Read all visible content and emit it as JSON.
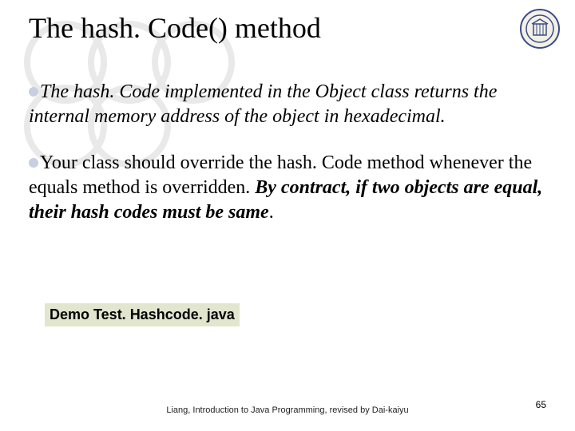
{
  "title": "The hash. Code() method",
  "bullets": {
    "b1": {
      "run1": "The hash. Code implemented in the Object class returns the internal memory address of the object in hexadecimal."
    },
    "b2": {
      "run1": "Your class should override the hash. Code method whenever the equals method is overridden. ",
      "run2": "By contract, if two objects are equal, their hash codes must be same",
      "run3": "."
    }
  },
  "demo_label": "Demo Test. Hashcode. java",
  "footer": "Liang, Introduction to Java Programming, revised by Dai-kaiyu",
  "page_number": "65"
}
